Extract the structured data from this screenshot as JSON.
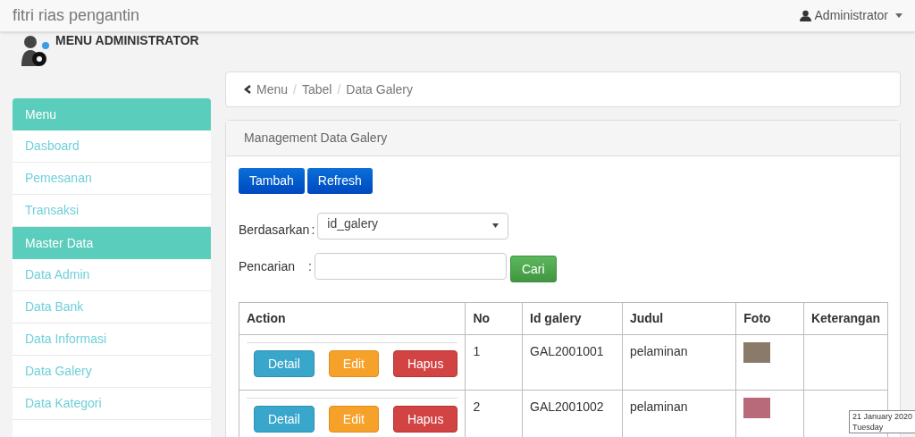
{
  "navbar": {
    "brand": "fitri rias pengantin",
    "user": "Administrator"
  },
  "sidebar": {
    "title": "MENU ADMINISTRATOR",
    "items": [
      {
        "label": "Menu",
        "kind": "header"
      },
      {
        "label": "Dasboard",
        "kind": "link"
      },
      {
        "label": "Pemesanan",
        "kind": "link"
      },
      {
        "label": "Transaksi",
        "kind": "link"
      },
      {
        "label": "Master Data",
        "kind": "header"
      },
      {
        "label": "Data Admin",
        "kind": "link"
      },
      {
        "label": "Data Bank",
        "kind": "link"
      },
      {
        "label": "Data Informasi",
        "kind": "link"
      },
      {
        "label": "Data Galery",
        "kind": "link"
      },
      {
        "label": "Data Kategori",
        "kind": "link"
      }
    ]
  },
  "breadcrumb": [
    {
      "label": "Menu"
    },
    {
      "separator": "/",
      "label": "Tabel"
    },
    {
      "separator": "/",
      "label": "Data Galery"
    }
  ],
  "panel": {
    "title": "Management Data Galery",
    "buttons": [
      "Tambah",
      "Refresh"
    ],
    "filter": {
      "label": "Berdasarkan",
      "separator": ":",
      "value": "id_galery"
    },
    "search": {
      "label": "Pencarian",
      "separator": ":",
      "button": "Cari"
    },
    "table": {
      "columns": [
        "Action",
        "No",
        "Id galery",
        "Judul",
        "Foto",
        "Keterangan"
      ],
      "rows": [
        {
          "actions": [
            {
              "label": "Detail",
              "kind": "info"
            },
            {
              "label": "Edit",
              "kind": "warning"
            },
            {
              "label": "Hapus",
              "kind": "danger"
            }
          ],
          "no": "1",
          "id": "GAL2001001",
          "judul": "pelaminan"
        },
        {
          "actions": [
            {
              "label": "Detail",
              "kind": "info"
            },
            {
              "label": "Edit",
              "kind": "warning"
            },
            {
              "label": "Hapus",
              "kind": "danger"
            }
          ],
          "no": "2",
          "id": "GAL2001002",
          "judul": "pelaminan"
        }
      ]
    }
  },
  "tooltip": {
    "date": "21 January 2020",
    "day": "Tuesday"
  }
}
